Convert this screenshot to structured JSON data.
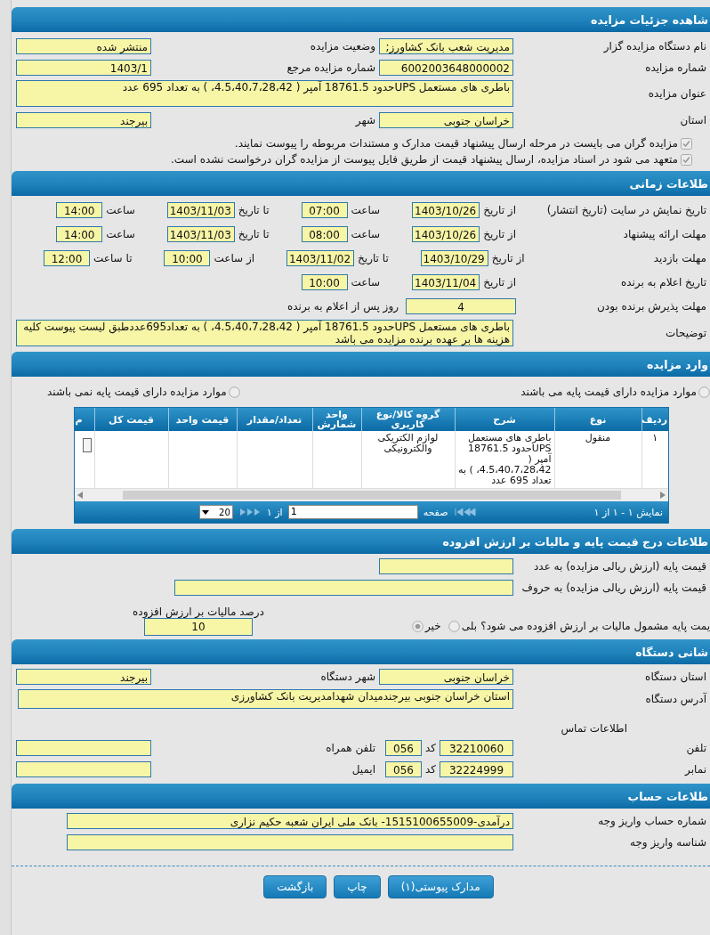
{
  "details": {
    "title": "شاهده جزئیات مزایده",
    "organizer": {
      "label": "نام دستگاه مزایده گزار",
      "value": "مدیریت شعب بانک کشاورز;"
    },
    "status": {
      "label": "وضعیت مزایده",
      "value": "منتشر شده"
    },
    "number": {
      "label": "شماره مزایده",
      "value": "6002003648000002"
    },
    "ref_number": {
      "label": "شماره مزایده مرجع",
      "value": "1403/1"
    },
    "subject": {
      "label": "عنوان مزایده",
      "value": "باطری های مستعمل UPSحدود 18761.5 آمپر ( 4.5،40،7،28،42، )  به تعداد 695 عدد"
    },
    "province": {
      "label": "استان",
      "value": "خراسان جنوبی"
    },
    "city": {
      "label": "شهر",
      "value": "بیرجند"
    },
    "checks": [
      {
        "label": "مزایده گران می بایست در مرحله ارسال پیشنهاد قیمت مدارک و مستندات مربوطه را پیوست نمایند.",
        "checked": true
      },
      {
        "label": "متعهد می شود در اسناد مزایده، ارسال پیشنهاد قیمت از طریق فایل پیوست از مزایده گران درخواست نشده است.",
        "checked": true
      }
    ]
  },
  "timing": {
    "title": "طلاعات زمانی",
    "rows": [
      {
        "label": "تاریخ نمایش در سایت (تاریخ انتشار)",
        "cells": [
          {
            "label": "از تاریخ",
            "value": "1403/10/26"
          },
          {
            "label": "ساعت",
            "value": "07:00"
          },
          {
            "label": "تا تاریخ",
            "value": "1403/11/03"
          },
          {
            "label": "ساعت",
            "value": "14:00"
          }
        ]
      },
      {
        "label": "مهلت ارائه پیشنهاد",
        "cells": [
          {
            "label": "از تاریخ",
            "value": "1403/10/26"
          },
          {
            "label": "ساعت",
            "value": "08:00"
          },
          {
            "label": "تا تاریخ",
            "value": "1403/11/03"
          },
          {
            "label": "ساعت",
            "value": "14:00"
          }
        ]
      },
      {
        "label": "مهلت بازدید",
        "cells": [
          {
            "label": "از تاریخ",
            "value": "1403/10/29"
          },
          {
            "label": "تا تاریخ",
            "value": "1403/11/02"
          },
          {
            "label": "از ساعت",
            "value": "10:00"
          },
          {
            "label": "تا ساعت",
            "value": "12:00"
          }
        ]
      },
      {
        "label": "تاریخ اعلام به برنده",
        "cells": [
          {
            "label": "از تاریخ",
            "value": "1403/11/04"
          },
          {
            "label": "ساعت",
            "value": "10:00"
          }
        ]
      }
    ],
    "winner_accept": {
      "label": "مهلت پذیرش برنده بودن",
      "value": "4",
      "suffix": "روز پس از اعلام به برنده"
    },
    "notes": {
      "label": "توضیحات",
      "value": "باطری های مستعمل UPSحدود 18761.5 آمپر ( 4.5،40،7،28،42، )  به تعداد695عددطبق لیست پیوست کلیه هزینه ها بر عهده برنده مزایده می باشد"
    }
  },
  "items": {
    "title": "وارد مزایده",
    "radios": [
      {
        "label": "موارد مزایده دارای قیمت پایه می باشند",
        "selected": false
      },
      {
        "label": "موارد مزایده دارای قیمت پایه نمی باشند",
        "selected": false
      }
    ],
    "table": {
      "columns": [
        "ردیف",
        "نوع",
        "شرح",
        "گروه کالا/نوع کاربری",
        "واحد شمارش",
        "تعداد/مقدار",
        "قیمت واحد",
        "قیمت کل",
        "م"
      ],
      "rows": [
        {
          "row_no": "١",
          "type": "منقول",
          "description": "باطری های مستعمل UPSحدود 18761.5 آمپر ( 4.5،40،7،28،42، )  به تعداد 695 عدد",
          "group": "لوازم الکتریکی والکترونیکی"
        }
      ]
    },
    "pager": {
      "summary": "نمایش ١ - ١ از ١",
      "page_label": "صفحه",
      "page": "1",
      "of": "از ١",
      "page_size": "20"
    }
  },
  "pricing": {
    "title": "طلاعات درج قیمت پایه و مالیات بر ارزش افزوده",
    "base_number": {
      "label": "قیمت پایه (ارزش ریالی مزایده) به عدد"
    },
    "base_words": {
      "label": "قیمت پایه (ارزش ریالی مزایده) به حروف"
    },
    "vat_question": {
      "label": "یمت پایه مشمول مالیات بر ارزش افزوده می شود؟",
      "options": [
        {
          "label": "بلی",
          "selected": false
        },
        {
          "label": "خیر",
          "selected": true
        }
      ]
    },
    "vat_percent": {
      "label": "درصد مالیات بر ارزش افزوده",
      "value": "10"
    }
  },
  "device": {
    "title": "شانی دستگاه",
    "province": {
      "label": "استان دستگاه",
      "value": "خراسان جنوبی"
    },
    "city": {
      "label": "شهر دستگاه",
      "value": "بیرجند"
    },
    "address": {
      "label": "آدرس دستگاه",
      "value": "استان خراسان جنوبی بیرجندمیدان شهدامدیریت بانک کشاورزی"
    },
    "contact_title": "اطلاعات تماس",
    "phone": {
      "label": "تلفن",
      "value": "32210060",
      "code_label": "کد",
      "code": "056"
    },
    "mobile": {
      "label": "تلفن همراه"
    },
    "fax": {
      "label": "نمابر",
      "value": "32224999",
      "code_label": "کد",
      "code": "056"
    },
    "email": {
      "label": "ایمیل"
    }
  },
  "account": {
    "title": "طلاعات حساب",
    "account_number": {
      "label": "شماره حساب واریز وجه",
      "value": "درآمدی-1515100655009- بانک ملی ایران شعبه حکیم نزاری"
    },
    "payment_id": {
      "label": "شناسه واریز وجه"
    }
  },
  "buttons": [
    "مدارک پیوستی(١)",
    "چاپ",
    "بازگشت"
  ]
}
